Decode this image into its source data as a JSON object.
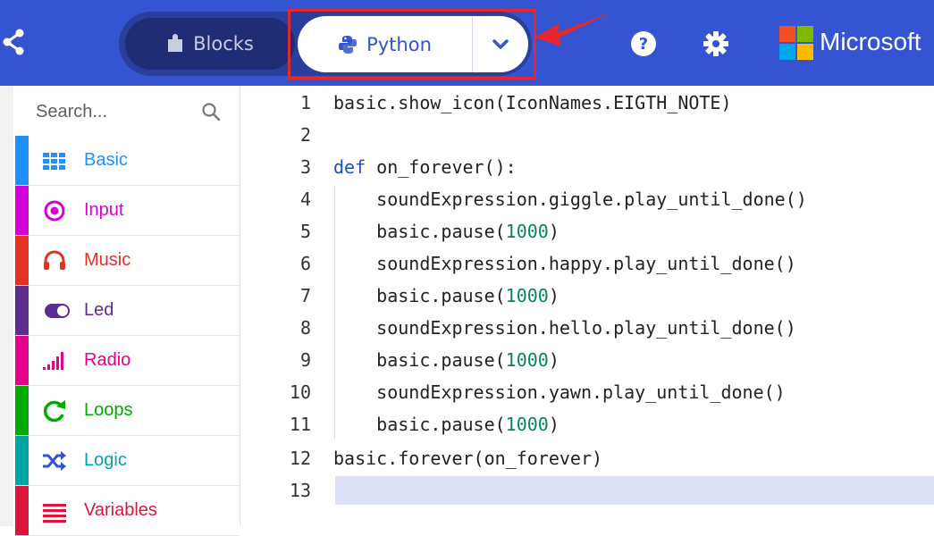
{
  "header": {
    "blocks_label": "Blocks",
    "python_label": "Python",
    "brand": "Microsoft",
    "colors": {
      "bar": "#3454d1",
      "highlight": "#e8262d"
    }
  },
  "sidebar": {
    "search_placeholder": "Search...",
    "categories": [
      {
        "label": "Basic",
        "icon": "grid-icon",
        "color": "#1e90ff"
      },
      {
        "label": "Input",
        "icon": "target-icon",
        "color": "#d400d4"
      },
      {
        "label": "Music",
        "icon": "headphones-icon",
        "color": "#e63022"
      },
      {
        "label": "Led",
        "icon": "toggle-icon",
        "color": "#5c2d91"
      },
      {
        "label": "Radio",
        "icon": "signal-bars-icon",
        "color": "#e3008c"
      },
      {
        "label": "Loops",
        "icon": "loop-arrow-icon",
        "color": "#00aa00"
      },
      {
        "label": "Logic",
        "icon": "shuffle-icon",
        "color": "#00a4a6"
      },
      {
        "label": "Variables",
        "icon": "list-lines-icon",
        "color": "#dc143c"
      }
    ]
  },
  "editor": {
    "lines": [
      {
        "num": "1",
        "code": "basic.show_icon(IconNames.EIGTH_NOTE)"
      },
      {
        "num": "2",
        "code": ""
      },
      {
        "num": "3",
        "code": "def on_forever():"
      },
      {
        "num": "4",
        "code": "    soundExpression.giggle.play_until_done()"
      },
      {
        "num": "5",
        "code": "    basic.pause(1000)"
      },
      {
        "num": "6",
        "code": "    soundExpression.happy.play_until_done()"
      },
      {
        "num": "7",
        "code": "    basic.pause(1000)"
      },
      {
        "num": "8",
        "code": "    soundExpression.hello.play_until_done()"
      },
      {
        "num": "9",
        "code": "    basic.pause(1000)"
      },
      {
        "num": "10",
        "code": "    soundExpression.yawn.play_until_done()"
      },
      {
        "num": "11",
        "code": "    basic.pause(1000)"
      },
      {
        "num": "12",
        "code": "basic.forever(on_forever)"
      },
      {
        "num": "13",
        "code": ""
      }
    ]
  }
}
